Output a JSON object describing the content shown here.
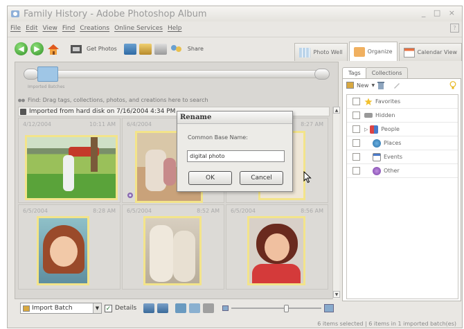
{
  "window": {
    "title": "Family History - Adobe Photoshop Album",
    "controls": "_ □ ×"
  },
  "menu": [
    "File",
    "Edit",
    "View",
    "Find",
    "Creations",
    "Online Services",
    "Help"
  ],
  "help_button": "?",
  "toolbar": {
    "get_photos": "Get Photos",
    "share": "Share",
    "tabs": [
      "Photo Well",
      "Organize",
      "Calendar View"
    ]
  },
  "timeline": {
    "label": "Imported Batches"
  },
  "find_hint": "Find: Drag tags, collections, photos, and creations here to search",
  "group_header": "Imported from hard disk on 7/16/2004 4:34 PM",
  "photos": [
    {
      "date": "4/12/2004",
      "time": "10:11 AM"
    },
    {
      "date": "6/4/2004",
      "time": ""
    },
    {
      "date": "",
      "time": "8:27 AM"
    },
    {
      "date": "6/5/2004",
      "time": "8:28 AM"
    },
    {
      "date": "6/5/2004",
      "time": "8:52 AM"
    },
    {
      "date": "6/5/2004",
      "time": "8:56 AM"
    }
  ],
  "bottom": {
    "arrangement": "Import Batch",
    "details_label": "Details"
  },
  "status": "6 items selected  |  6 items in 1 imported batch(es)",
  "tags_panel": {
    "tabs": [
      "Tags",
      "Collections"
    ],
    "new_label": "New",
    "items": [
      "Favorites",
      "Hidden",
      "People",
      "Places",
      "Events",
      "Other"
    ]
  },
  "dialog": {
    "title": "Rename",
    "label": "Common Base Name:",
    "value": "digital photo",
    "ok": "OK",
    "cancel": "Cancel"
  },
  "colors": {
    "highlight_border": "#f3e48a",
    "accent_green": "#2f8f24"
  }
}
